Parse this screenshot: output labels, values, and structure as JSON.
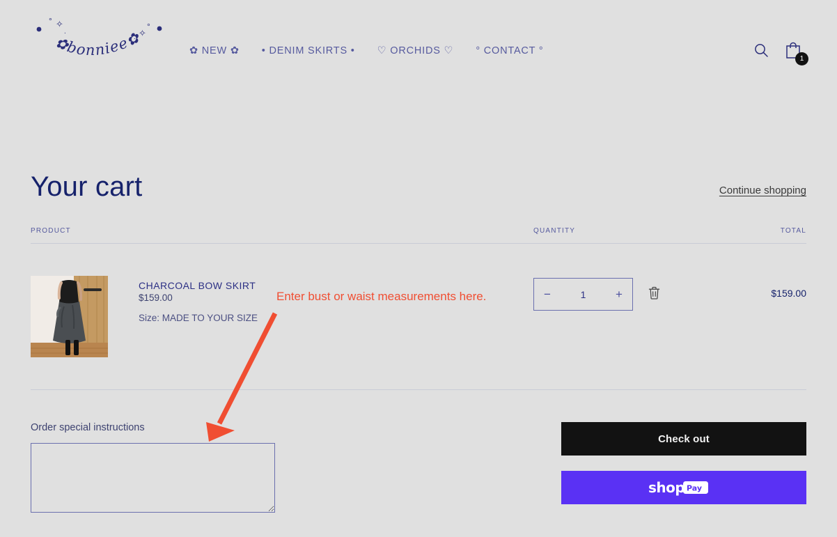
{
  "theme": {
    "page_background": "#e0e0e0",
    "brand_navy": "#2b2e7a",
    "title_navy": "#16226b",
    "nav_purple": "#565a9e",
    "annotation_red": "#f04e32",
    "checkout_black": "#121212",
    "shoppay_purple": "#5a31f4",
    "border_grey": "#c9cbd6",
    "input_border": "#6a6fae"
  },
  "header": {
    "logo_text": "bonniee",
    "logo_name": "bonniee-logo",
    "nav": [
      {
        "label": "✿ NEW ✿",
        "name": "nav-new"
      },
      {
        "label": "• DENIM SKIRTS •",
        "name": "nav-denim-skirts"
      },
      {
        "label": "♡ ORCHIDS ♡",
        "name": "nav-orchids"
      },
      {
        "label": "° CONTACT °",
        "name": "nav-contact"
      }
    ],
    "search_icon": "search-icon",
    "cart_icon": "shopping-bag-icon",
    "cart_count": "1"
  },
  "cart": {
    "title": "Your cart",
    "continue_shopping": "Continue shopping",
    "columns": {
      "product": "PRODUCT",
      "quantity": "QUANTITY",
      "total": "TOTAL"
    },
    "items": [
      {
        "title": "CHARCOAL BOW SKIRT",
        "price": "$159.00",
        "variant": "Size: MADE TO YOUR SIZE",
        "quantity": "1",
        "total": "$159.00",
        "decrease_label": "−",
        "increase_label": "+",
        "remove_icon": "trash-icon",
        "image_alt": "Model wearing charcoal bow skirt with black top beside a wooden door"
      }
    ],
    "instructions_label": "Order special instructions",
    "instructions_value": "",
    "instructions_placeholder": "",
    "checkout_label": "Check out",
    "shoppay_label": "shop Pay"
  },
  "annotation": {
    "text": "Enter bust or waist measurements here.",
    "arrow_name": "annotation-arrow",
    "color": "#f04e32"
  }
}
